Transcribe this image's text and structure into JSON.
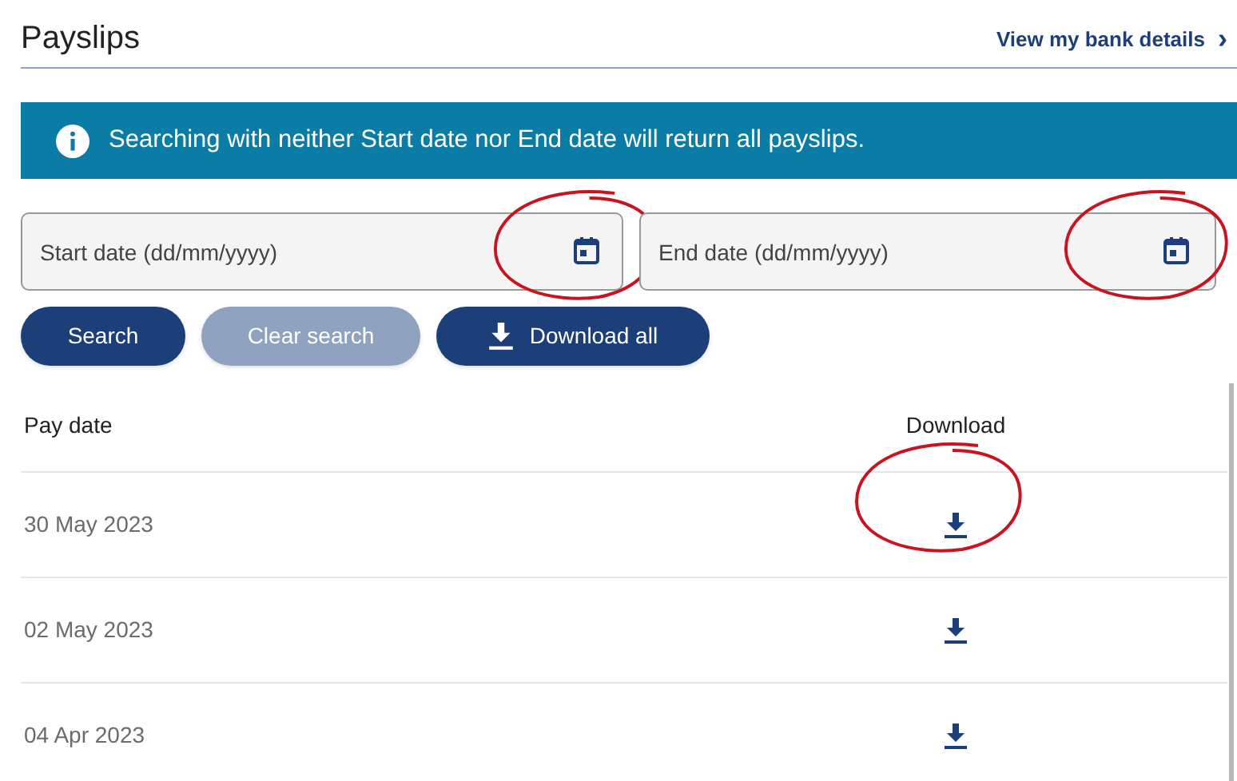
{
  "page_title": "Payslips",
  "bank_link": {
    "label": "View my bank details",
    "chevron": "›"
  },
  "info_banner": {
    "text": "Searching with neither Start date nor End date will return all payslips."
  },
  "date_fields": [
    {
      "placeholder": "Start date (dd/mm/yyyy)",
      "circled": true
    },
    {
      "placeholder": "End date (dd/mm/yyyy)",
      "circled": true
    }
  ],
  "buttons": [
    {
      "label": "Search",
      "kind": "primary",
      "disabled": false
    },
    {
      "label": "Clear search",
      "kind": "plain",
      "disabled": true
    },
    {
      "label": "Download all",
      "kind": "download",
      "disabled": false
    }
  ],
  "table": {
    "columns": [
      "Pay date",
      "Download"
    ],
    "rows": [
      {
        "pay_date": "30 May 2023",
        "circled": true
      },
      {
        "pay_date": "02 May 2023",
        "circled": false
      },
      {
        "pay_date": "04 Apr 2023",
        "circled": false
      }
    ]
  }
}
